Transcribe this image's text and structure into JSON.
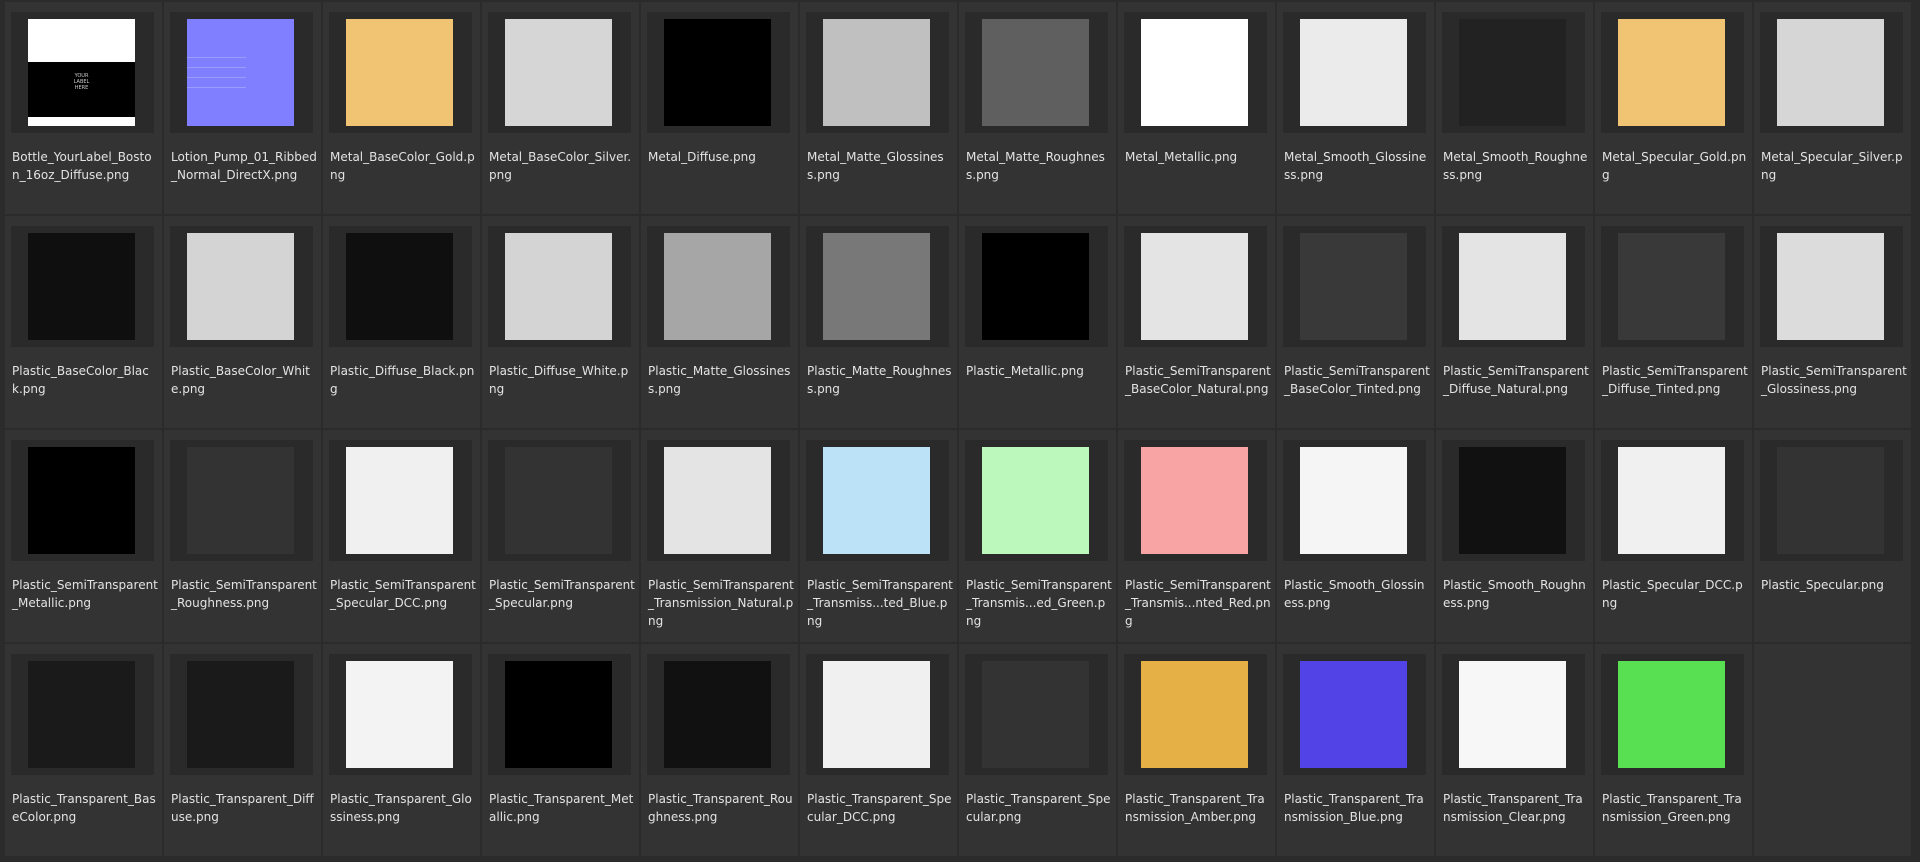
{
  "files": [
    {
      "name": "Bottle_YourLabel_Boston_16oz_Diffuse.png",
      "color": "#000000",
      "preview": "label",
      "preview_text": "YOUR\nLABEL\nHERE"
    },
    {
      "name": "Lotion_Pump_01_Ribbed_Normal_DirectX.png",
      "color": "#7f7fff",
      "preview": "normal"
    },
    {
      "name": "Metal_BaseColor_Gold.png",
      "color": "#f1c474"
    },
    {
      "name": "Metal_BaseColor_Silver.png",
      "color": "#d6d6d6"
    },
    {
      "name": "Metal_Diffuse.png",
      "color": "#000000"
    },
    {
      "name": "Metal_Matte_Glossiness.png",
      "color": "#c0c0c0"
    },
    {
      "name": "Metal_Matte_Roughness.png",
      "color": "#5f5f5f"
    },
    {
      "name": "Metal_Metallic.png",
      "color": "#ffffff"
    },
    {
      "name": "Metal_Smooth_Glossiness.png",
      "color": "#ebebeb"
    },
    {
      "name": "Metal_Smooth_Roughness.png",
      "color": "#222222"
    },
    {
      "name": "Metal_Specular_Gold.png",
      "color": "#f1c474"
    },
    {
      "name": "Metal_Specular_Silver.png",
      "color": "#d6d6d6"
    },
    {
      "name": "Plastic_BaseColor_Black.png",
      "color": "#0f0f0f"
    },
    {
      "name": "Plastic_BaseColor_White.png",
      "color": "#d4d4d4"
    },
    {
      "name": "Plastic_Diffuse_Black.png",
      "color": "#0f0f0f"
    },
    {
      "name": "Plastic_Diffuse_White.png",
      "color": "#d4d4d4"
    },
    {
      "name": "Plastic_Matte_Glossiness.png",
      "color": "#a6a6a6"
    },
    {
      "name": "Plastic_Matte_Roughness.png",
      "color": "#787878"
    },
    {
      "name": "Plastic_Metallic.png",
      "color": "#000000"
    },
    {
      "name": "Plastic_SemiTransparent_BaseColor_Natural.png",
      "color": "#e4e4e4"
    },
    {
      "name": "Plastic_SemiTransparent_BaseColor_Tinted.png",
      "color": "#393939"
    },
    {
      "name": "Plastic_SemiTransparent_Diffuse_Natural.png",
      "color": "#e4e4e4"
    },
    {
      "name": "Plastic_SemiTransparent_Diffuse_Tinted.png",
      "color": "#393939"
    },
    {
      "name": "Plastic_SemiTransparent_Glossiness.png",
      "color": "#dcdcdc"
    },
    {
      "name": "Plastic_SemiTransparent_Metallic.png",
      "color": "#000000"
    },
    {
      "name": "Plastic_SemiTransparent_Roughness.png",
      "color": "#333333"
    },
    {
      "name": "Plastic_SemiTransparent_Specular_DCC.png",
      "color": "#f0f0f0"
    },
    {
      "name": "Plastic_SemiTransparent_Specular.png",
      "color": "#333333"
    },
    {
      "name": "Plastic_SemiTransparent_Transmission_Natural.png",
      "color": "#e4e4e4"
    },
    {
      "name": "Plastic_SemiTransparent_Transmiss...ted_Blue.png",
      "color": "#bce2f8"
    },
    {
      "name": "Plastic_SemiTransparent_Transmis...ed_Green.png",
      "color": "#bcf8bc"
    },
    {
      "name": "Plastic_SemiTransparent_Transmis...nted_Red.png",
      "color": "#f8a4a4"
    },
    {
      "name": "Plastic_Smooth_Glossiness.png",
      "color": "#f5f5f5"
    },
    {
      "name": "Plastic_Smooth_Roughness.png",
      "color": "#111111"
    },
    {
      "name": "Plastic_Specular_DCC.png",
      "color": "#f0f0f0"
    },
    {
      "name": "Plastic_Specular.png",
      "color": "#333333"
    },
    {
      "name": "Plastic_Transparent_BaseColor.png",
      "color": "#1a1a1a"
    },
    {
      "name": "Plastic_Transparent_Diffuse.png",
      "color": "#1a1a1a"
    },
    {
      "name": "Plastic_Transparent_Glossiness.png",
      "color": "#f3f3f3"
    },
    {
      "name": "Plastic_Transparent_Metallic.png",
      "color": "#000000"
    },
    {
      "name": "Plastic_Transparent_Roughness.png",
      "color": "#111111"
    },
    {
      "name": "Plastic_Transparent_Specular_DCC.png",
      "color": "#f0f0f0"
    },
    {
      "name": "Plastic_Transparent_Specular.png",
      "color": "#333333"
    },
    {
      "name": "Plastic_Transparent_Transmission_Amber.png",
      "color": "#e5b045"
    },
    {
      "name": "Plastic_Transparent_Transmission_Blue.png",
      "color": "#5143e5"
    },
    {
      "name": "Plastic_Transparent_Transmission_Clear.png",
      "color": "#f7f7f7"
    },
    {
      "name": "Plastic_Transparent_Transmission_Green.png",
      "color": "#58e052"
    }
  ],
  "columns": 12
}
